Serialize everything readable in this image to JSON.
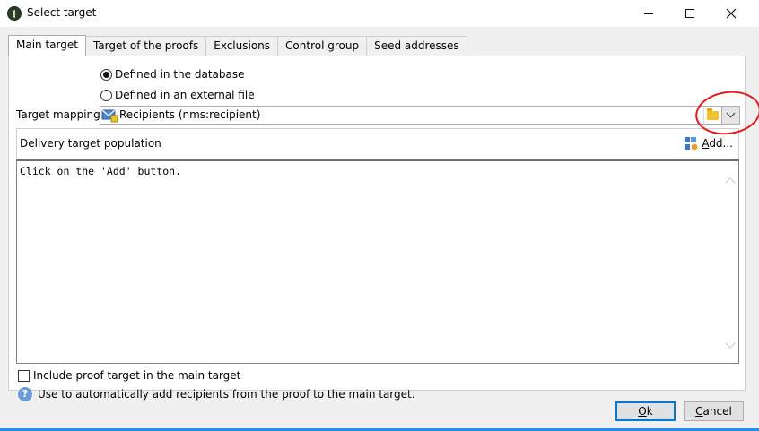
{
  "window": {
    "title": "Select target",
    "icons": {
      "app": "app-logo-icon",
      "minimize": "minimize-icon",
      "maximize": "maximize-icon",
      "close": "close-icon"
    }
  },
  "tabs": [
    {
      "label": "Main target",
      "active": true
    },
    {
      "label": "Target of the proofs",
      "active": false
    },
    {
      "label": "Exclusions",
      "active": false
    },
    {
      "label": "Control group",
      "active": false
    },
    {
      "label": "Seed addresses",
      "active": false
    }
  ],
  "source": {
    "option_database": "Defined in the database",
    "option_external": "Defined in an external file",
    "selected": "database"
  },
  "mapping": {
    "label": "Target mapping:",
    "value": "Recipients (nms:recipient)",
    "icons": {
      "mapping": "recipient-mapping-icon",
      "browse": "folder-icon",
      "dropdown": "chevron-down-icon"
    }
  },
  "population": {
    "title": "Delivery target population",
    "add_label": "Add...",
    "empty_text": "Click on the 'Add' button.",
    "icons": {
      "add": "add-filter-icon"
    }
  },
  "proof": {
    "checkbox_label": "Include proof target in the main target",
    "checked": false,
    "info_text": "Use to automatically add recipients from the proof to the main target.",
    "icons": {
      "info": "info-icon"
    }
  },
  "buttons": {
    "ok": "Ok",
    "cancel": "Cancel"
  },
  "colors": {
    "annotation": "#e8181b",
    "accent": "#0078d7"
  }
}
